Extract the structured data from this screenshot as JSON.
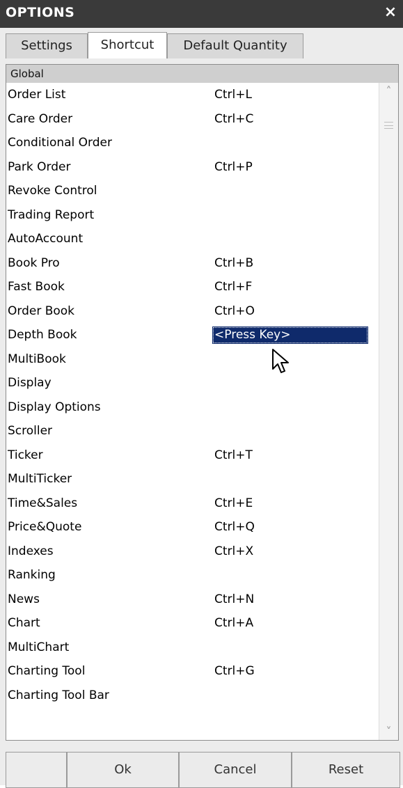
{
  "window": {
    "title": "OPTIONS",
    "close_glyph": "×"
  },
  "tabs": [
    {
      "label": "Settings",
      "active": false
    },
    {
      "label": "Shortcut",
      "active": true
    },
    {
      "label": "Default Quantity",
      "active": false
    }
  ],
  "group": {
    "title": "Global"
  },
  "rows": [
    {
      "label": "Order List",
      "key": "Ctrl+L"
    },
    {
      "label": "Care Order",
      "key": "Ctrl+C"
    },
    {
      "label": "Conditional Order",
      "key": ""
    },
    {
      "label": "Park Order",
      "key": "Ctrl+P"
    },
    {
      "label": "Revoke Control",
      "key": ""
    },
    {
      "label": "Trading Report",
      "key": ""
    },
    {
      "label": "AutoAccount",
      "key": ""
    },
    {
      "label": "Book Pro",
      "key": "Ctrl+B"
    },
    {
      "label": "Fast Book",
      "key": "Ctrl+F"
    },
    {
      "label": "Order Book",
      "key": "Ctrl+O"
    },
    {
      "label": "Depth Book",
      "key": "<Press Key>"
    },
    {
      "label": "MultiBook",
      "key": ""
    },
    {
      "label": "Display",
      "key": ""
    },
    {
      "label": "Display Options",
      "key": ""
    },
    {
      "label": "Scroller",
      "key": ""
    },
    {
      "label": "Ticker",
      "key": "Ctrl+T"
    },
    {
      "label": "MultiTicker",
      "key": ""
    },
    {
      "label": "Time&Sales",
      "key": "Ctrl+E"
    },
    {
      "label": "Price&Quote",
      "key": "Ctrl+Q"
    },
    {
      "label": "Indexes",
      "key": "Ctrl+X"
    },
    {
      "label": "Ranking",
      "key": ""
    },
    {
      "label": "News",
      "key": "Ctrl+N"
    },
    {
      "label": "Chart",
      "key": "Ctrl+A"
    },
    {
      "label": "MultiChart",
      "key": ""
    },
    {
      "label": "Charting Tool",
      "key": "Ctrl+G"
    },
    {
      "label": "Charting Tool Bar",
      "key": ""
    }
  ],
  "buttons": {
    "ok": "Ok",
    "cancel": "Cancel",
    "reset": "Reset"
  },
  "icons": {
    "scroll_up": "chevron-up-icon",
    "scroll_down": "chevron-down-icon",
    "pointer": "mouse-pointer-icon"
  },
  "colors": {
    "titlebar": "#3a3a3a",
    "selection": "#0f2a6b",
    "group_header": "#cfcfcf"
  }
}
